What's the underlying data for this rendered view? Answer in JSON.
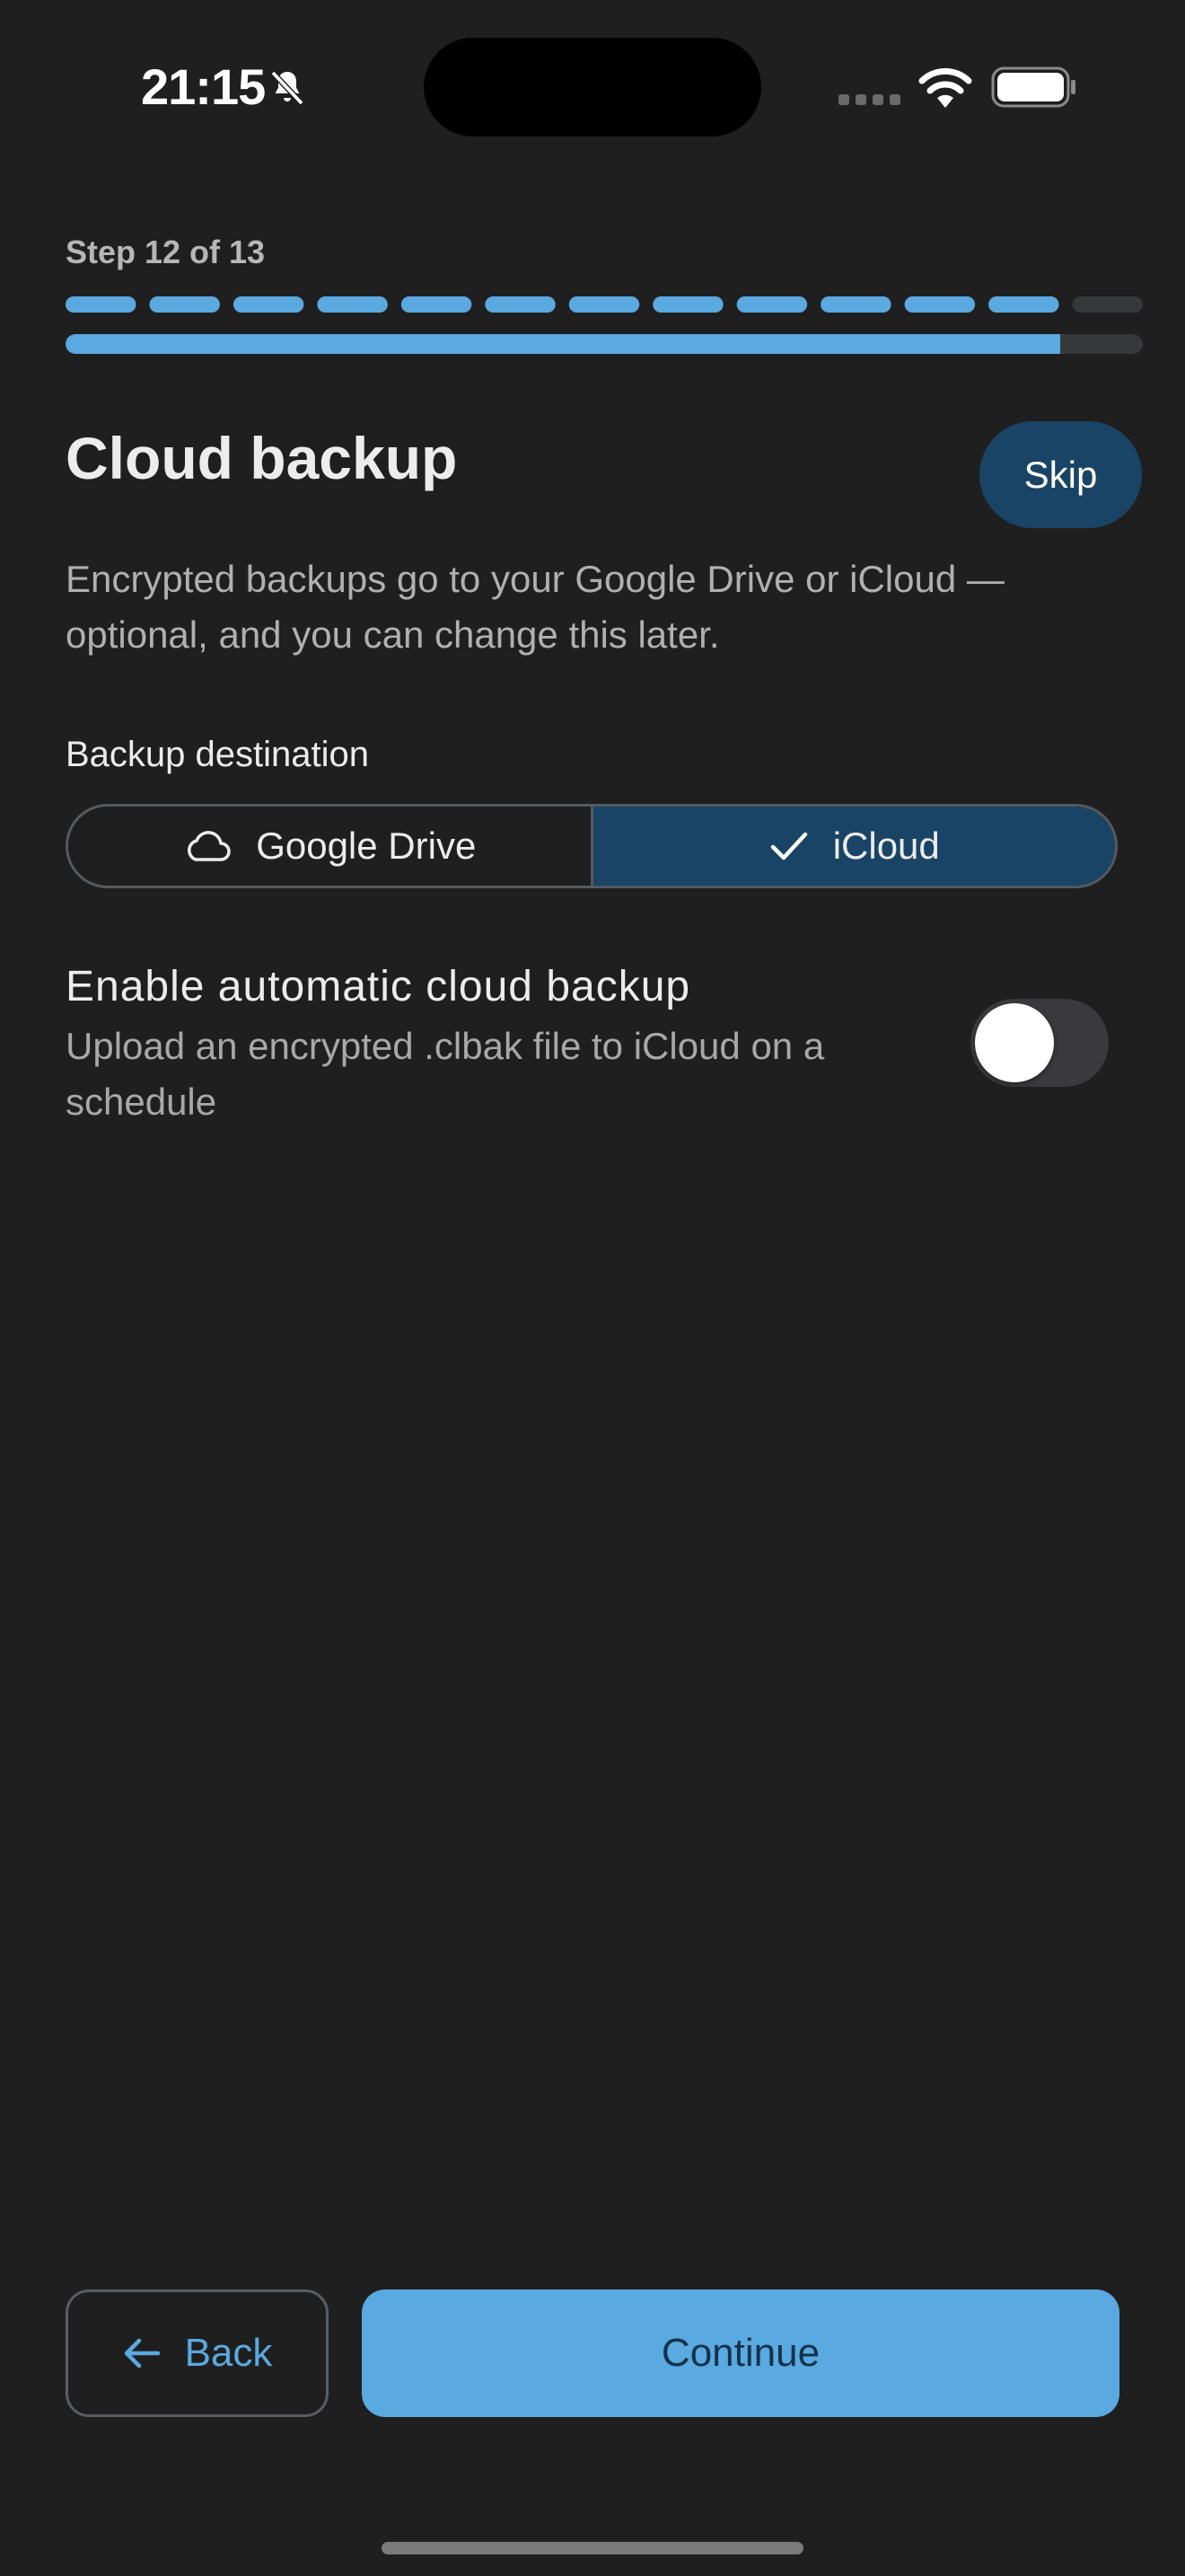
{
  "status_bar": {
    "time": "21:15",
    "icons": [
      "bell-slash-icon",
      "signal-dots-icon",
      "wifi-icon",
      "battery-icon"
    ]
  },
  "progress": {
    "step_label": "Step 12 of 13",
    "current_step": 12,
    "total_steps": 13,
    "fraction": 0.923,
    "accent_color": "#5aa9e0",
    "track_color": "#36383c"
  },
  "header": {
    "title": "Cloud backup",
    "skip_label": "Skip"
  },
  "subtitle": "Encrypted backups go to your Google Drive or iCloud — optional, and you can change this later.",
  "destination": {
    "label": "Backup destination",
    "options": [
      {
        "label": "Google Drive",
        "icon": "cloud-icon",
        "selected": false
      },
      {
        "label": "iCloud",
        "icon": "check-icon",
        "selected": true
      }
    ],
    "selected_color": "#1a4466"
  },
  "auto_backup": {
    "title": "Enable automatic cloud backup",
    "description": "Upload an encrypted .clbak file to iCloud on a schedule",
    "enabled": false
  },
  "footer": {
    "back_label": "Back",
    "continue_label": "Continue"
  }
}
